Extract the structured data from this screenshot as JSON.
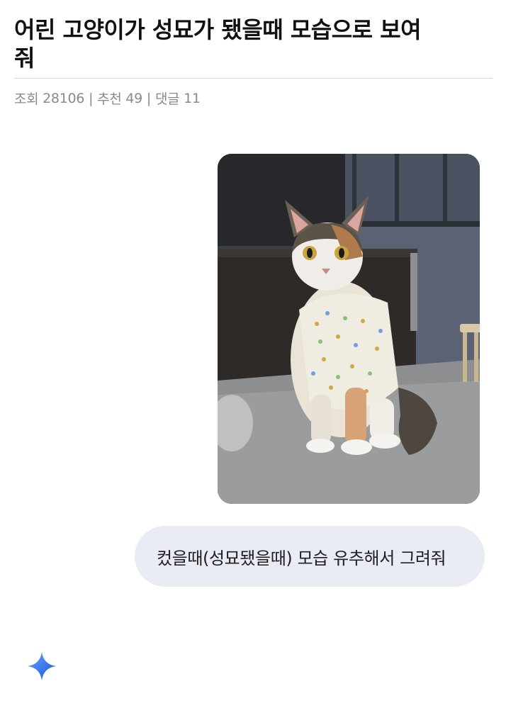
{
  "post": {
    "title": "어린 고양이가 성묘가 됐을때 모습으로 보여줘",
    "meta": {
      "views_label": "조회",
      "views": "28106",
      "recommend_label": "추천",
      "recommend": "49",
      "comments_label": "댓글",
      "comments": "11",
      "separator": "|"
    }
  },
  "chat": {
    "attachment": {
      "alt": ""
    },
    "user_message": "컸을때(성묘됐을때) 모습 유추해서 그려줘",
    "assistant_icon": "sparkle-icon"
  },
  "colors": {
    "bubble_bg": "#e9ecf4",
    "sparkle_start": "#4f8cf7",
    "sparkle_end": "#1a56d6",
    "meta_text": "#8a8a8a"
  }
}
